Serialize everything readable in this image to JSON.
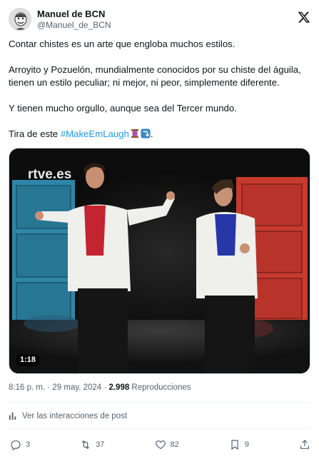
{
  "author": {
    "display_name": "Manuel de BCN",
    "handle": "@Manuel_de_BCN"
  },
  "tweet": {
    "para1": "Contar chistes es un arte que engloba muchos estilos.",
    "para2_line1": "Arroyito y Pozuelón, mundialmente conocidos por su chiste del águila,",
    "para2_line2": "tienen un estilo peculiar; ni mejor, ni peor, simplemente diferente.",
    "para3": "Y tienen mucho orgullo, aunque sea del Tercer mundo.",
    "para4_prefix": "Tira de este ",
    "hashtag": "#MakeEmLaugh",
    "para4_suffix": "."
  },
  "media": {
    "watermark": "rtve.es",
    "duration": "1:18"
  },
  "meta": {
    "time": "8:16 p. m.",
    "separator1": " · ",
    "date": "29 may. 2024",
    "separator2": " · ",
    "views": "2.998",
    "views_label": " Reproducciones"
  },
  "analytics_label": "Ver las interacciones de post",
  "actions": {
    "replies": "3",
    "reposts": "37",
    "likes": "82",
    "bookmarks": "9"
  },
  "icons": {
    "logo": "x-logo-icon",
    "reply": "reply-icon",
    "repost": "repost-icon",
    "like": "heart-icon",
    "bookmark": "bookmark-icon",
    "share": "share-icon",
    "analytics": "bar-chart-icon"
  },
  "colors": {
    "text": "#0f1419",
    "secondary": "#536471",
    "link": "#1d9bf0",
    "divider": "#eff3f4"
  }
}
